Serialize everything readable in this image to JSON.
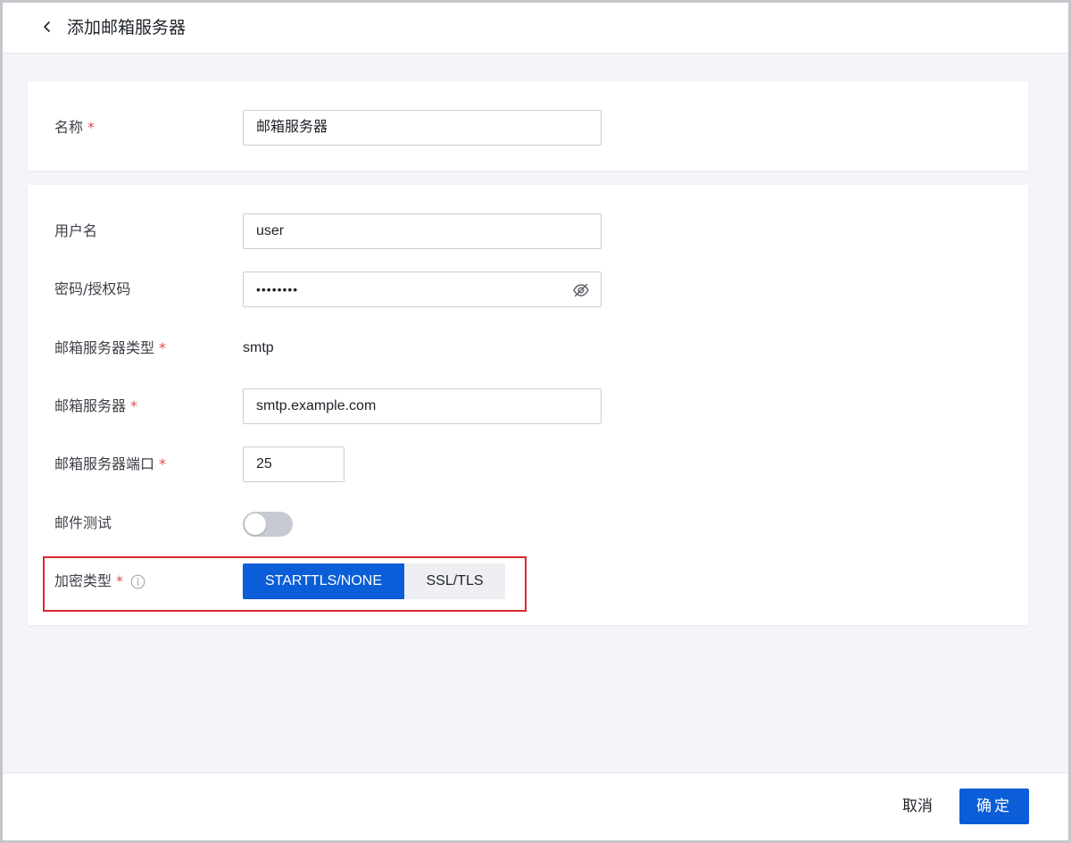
{
  "header": {
    "title": "添加邮箱服务器",
    "back_icon": "chevron-left-icon"
  },
  "basic": {
    "name_label": "名称",
    "name_value": "邮箱服务器",
    "required_mark": "*"
  },
  "settings": {
    "username_label": "用户名",
    "username_value": "user",
    "password_label": "密码/授权码",
    "password_value": "••••••••",
    "password_icon": "eye-off-icon",
    "server_type_label": "邮箱服务器类型",
    "server_type_value": "smtp",
    "server_label": "邮箱服务器",
    "server_value": "smtp.example.com",
    "port_label": "邮箱服务器端口",
    "port_value": "25",
    "mail_test_label": "邮件测试",
    "mail_test_enabled": false,
    "encryption_label": "加密类型",
    "encryption_info_icon": "info-icon",
    "encryption_options": [
      "STARTTLS/NONE",
      "SSL/TLS"
    ],
    "encryption_selected": "STARTTLS/NONE"
  },
  "footer": {
    "cancel_label": "取消",
    "ok_label": "确定"
  },
  "colors": {
    "primary": "#0b5ed7",
    "required": "#e34d59",
    "highlight": "#d9282f",
    "background": "#f4f5f8"
  }
}
